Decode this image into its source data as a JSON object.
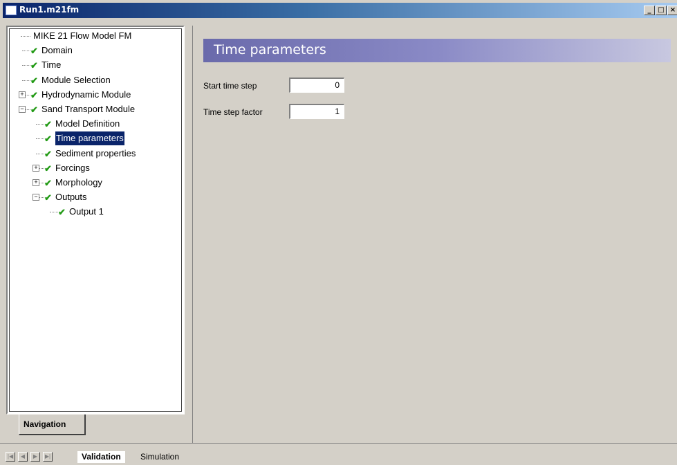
{
  "window": {
    "title": "Run1.m21fm",
    "controls": [
      "minimize",
      "maximize",
      "close"
    ],
    "control_glyphs": {
      "minimize": "_",
      "maximize": "□",
      "close": "×"
    }
  },
  "navigation": {
    "tab_label": "Navigation",
    "tree": [
      {
        "label": "MIKE 21 Flow Model FM",
        "level": 0,
        "checked": false,
        "expander": ""
      },
      {
        "label": "Domain",
        "level": 1,
        "checked": true,
        "expander": ""
      },
      {
        "label": "Time",
        "level": 1,
        "checked": true,
        "expander": ""
      },
      {
        "label": "Module Selection",
        "level": 1,
        "checked": true,
        "expander": ""
      },
      {
        "label": "Hydrodynamic Module",
        "level": 1,
        "checked": true,
        "expander": "+"
      },
      {
        "label": "Sand Transport Module",
        "level": 1,
        "checked": true,
        "expander": "−"
      },
      {
        "label": "Model Definition",
        "level": 2,
        "checked": true,
        "expander": ""
      },
      {
        "label": "Time parameters",
        "level": 2,
        "checked": true,
        "expander": "",
        "selected": true
      },
      {
        "label": "Sediment properties",
        "level": 2,
        "checked": true,
        "expander": ""
      },
      {
        "label": "Forcings",
        "level": 2,
        "checked": true,
        "expander": "+"
      },
      {
        "label": "Morphology",
        "level": 2,
        "checked": true,
        "expander": "+"
      },
      {
        "label": "Outputs",
        "level": 2,
        "checked": true,
        "expander": "−"
      },
      {
        "label": "Output 1",
        "level": 3,
        "checked": true,
        "expander": ""
      }
    ]
  },
  "content": {
    "header": "Time parameters",
    "fields": {
      "start_time_step": {
        "label": "Start time step",
        "value": "0"
      },
      "time_step_factor": {
        "label": "Time step factor",
        "value": "1"
      }
    }
  },
  "bottom": {
    "tabs": [
      "Validation",
      "Simulation"
    ],
    "active_tab": "Validation",
    "nav_buttons": [
      "first",
      "previous",
      "next",
      "last"
    ]
  },
  "colors": {
    "titlebar_start": "#0a246a",
    "titlebar_end": "#a6caf0",
    "header_band": "#8a8ac6",
    "check": "#229a15",
    "selection": "#0a246a"
  }
}
